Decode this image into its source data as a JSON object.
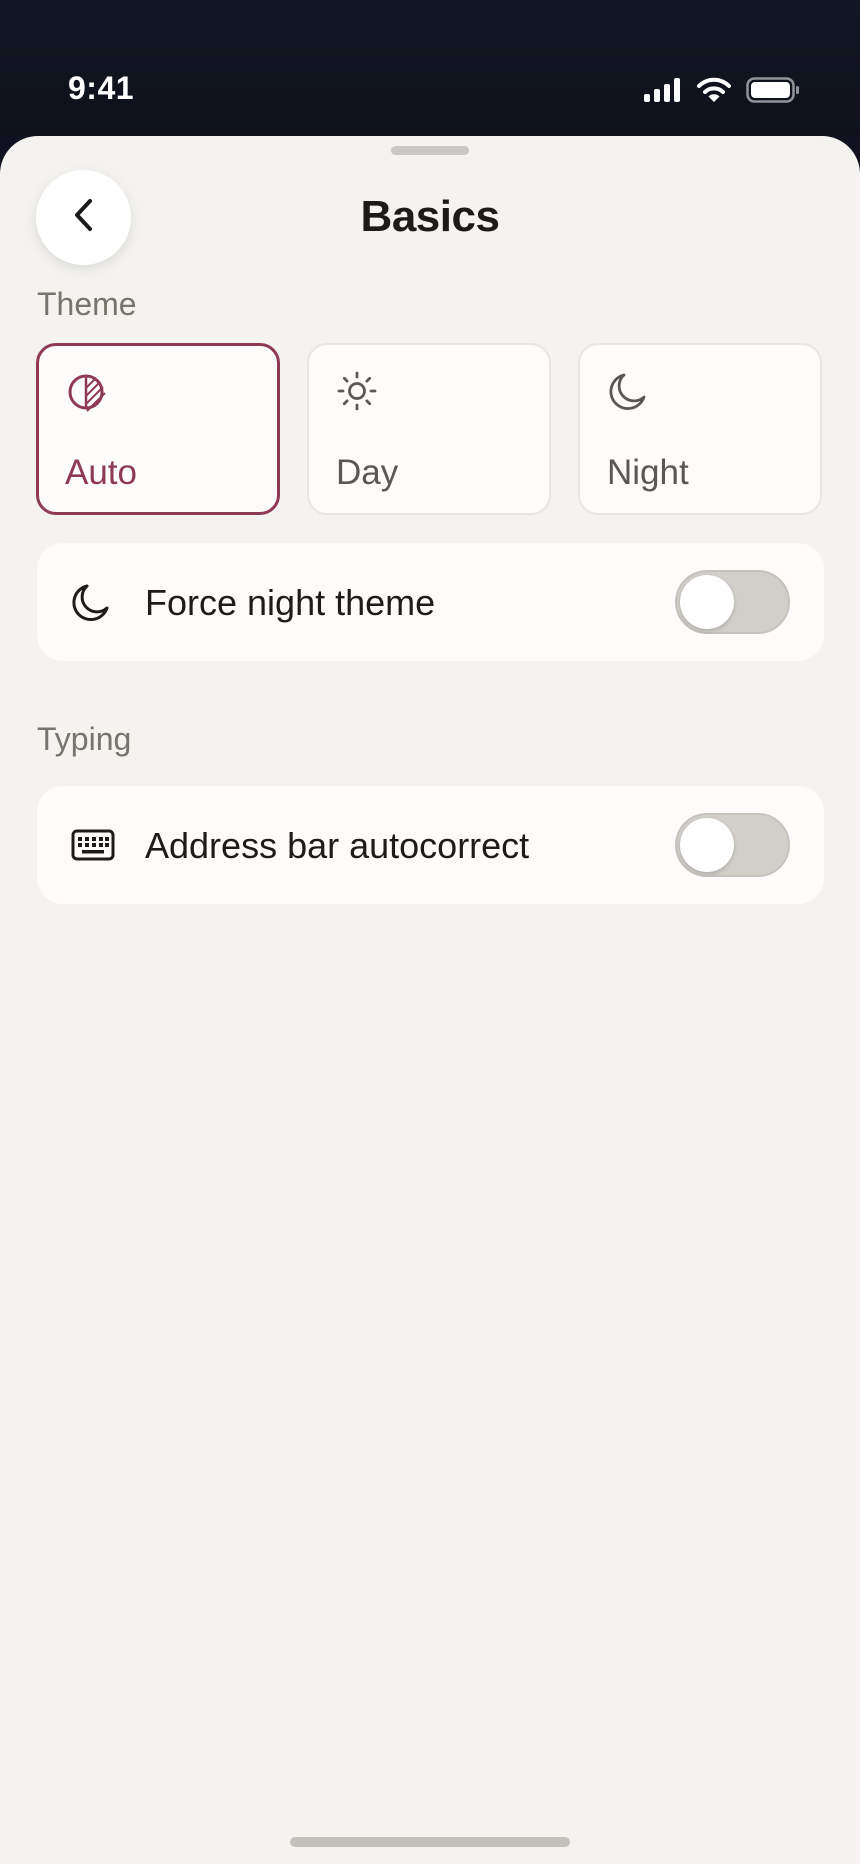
{
  "status_bar": {
    "time": "9:41",
    "icons": [
      "cellular-signal-icon",
      "wifi-icon",
      "battery-icon"
    ]
  },
  "header": {
    "title": "Basics",
    "back_icon": "chevron-left-icon"
  },
  "theme": {
    "section_label": "Theme",
    "options": [
      {
        "label": "Auto",
        "icon": "auto-theme-icon",
        "selected": true
      },
      {
        "label": "Day",
        "icon": "sun-icon",
        "selected": false
      },
      {
        "label": "Night",
        "icon": "moon-icon",
        "selected": false
      }
    ],
    "force_night": {
      "label": "Force night theme",
      "icon": "moon-icon",
      "enabled": false
    }
  },
  "typing": {
    "section_label": "Typing",
    "autocorrect": {
      "label": "Address bar autocorrect",
      "icon": "keyboard-icon",
      "enabled": false
    }
  },
  "colors": {
    "accent": "#8e3a55",
    "background": "#f4f3f0",
    "card": "#fdfcfa",
    "status_bar": "#10131f"
  }
}
